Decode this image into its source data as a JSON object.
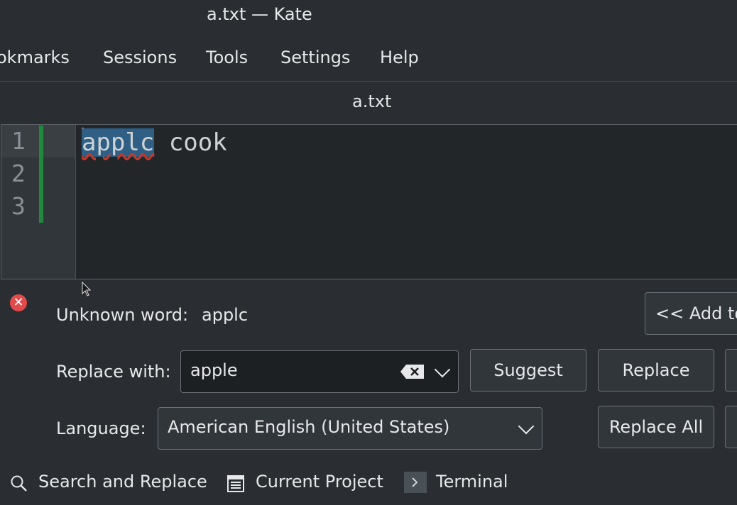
{
  "window": {
    "title": "a.txt — Kate"
  },
  "menu": {
    "items": [
      "okmarks",
      "Sessions",
      "Tools",
      "Settings",
      "Help"
    ]
  },
  "tab": {
    "label": "a.txt"
  },
  "editor": {
    "line_numbers": [
      "1",
      "2",
      "3"
    ],
    "misspelled": "applc",
    "rest": " cook"
  },
  "spellcheck": {
    "unknown_label": "Unknown word:",
    "unknown_word": "applc",
    "add_button": "<< Add to",
    "replace_label": "Replace with:",
    "replace_value": "apple",
    "suggest_button": "Suggest",
    "replace_button": "Replace",
    "language_label": "Language:",
    "language_value": "American English (United States)",
    "replace_all_button": "Replace All"
  },
  "bottom": {
    "search": "Search and Replace",
    "project": "Current Project",
    "terminal": "Terminal"
  },
  "colors": {
    "error": "#e24b4b",
    "modified": "#1f8a3c",
    "selection": "#2f5f84"
  }
}
